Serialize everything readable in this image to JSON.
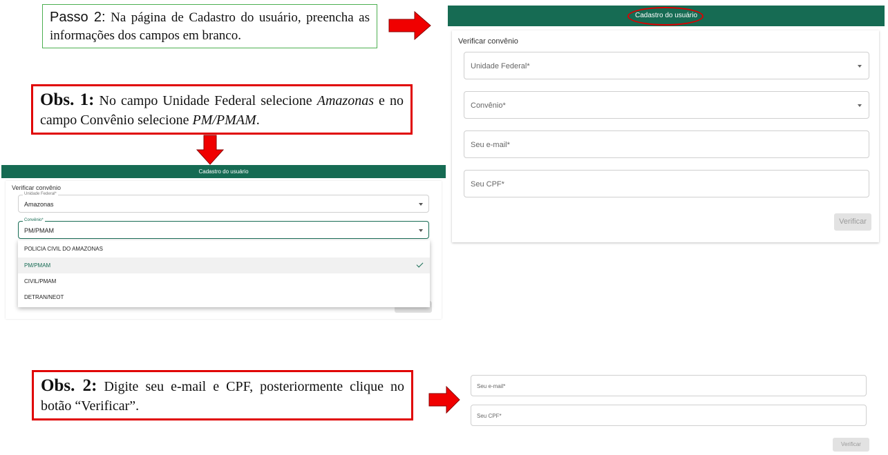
{
  "step": {
    "lead": "Passo 2:",
    "text": " Na página de Cadastro do usuário, preencha as informações dos campos em branco."
  },
  "obs1": {
    "bold": "Obs. 1:",
    "t1": " No campo Unidade Federal selecione ",
    "i1": "Amazonas",
    "t2": " e no campo Convênio selecione ",
    "i2": "PM/PMAM",
    "t3": "."
  },
  "obs2": {
    "bold": "Obs. 2:",
    "text": " Digite seu e-mail e CPF, posteriormente clique no botão “Verificar”."
  },
  "right_form": {
    "appbar_title": "Cadastro do usuário",
    "section_title": "Verificar convênio",
    "uf_label": "Unidade Federal*",
    "convenio_label": "Convênio*",
    "email_label": "Seu e-mail*",
    "cpf_label": "Seu CPF*",
    "verify_button": "Verificar"
  },
  "left_form": {
    "appbar_title": "Cadastro do usuário",
    "section_title": "Verificar convênio",
    "uf_label": "Unidade Federal*",
    "uf_value": "Amazonas",
    "convenio_label": "Convênio*",
    "convenio_value": "PM/PMAM",
    "options": [
      "POLICIA CIVIL DO AMAZONAS",
      "PM/PMAM",
      "CIVIL/PMAM",
      "DETRAN/NEOT"
    ],
    "selected_option": "PM/PMAM"
  },
  "bottom_form": {
    "email_label": "Seu e-mail*",
    "cpf_label": "Seu CPF*",
    "verify_button": "Verificar"
  },
  "colors": {
    "appbar": "#166b53",
    "highlight": "#e00000",
    "step_border": "#4caf50"
  },
  "icons": [
    "arrow-right-icon",
    "arrow-down-icon",
    "chevron-down-icon",
    "check-icon"
  ]
}
